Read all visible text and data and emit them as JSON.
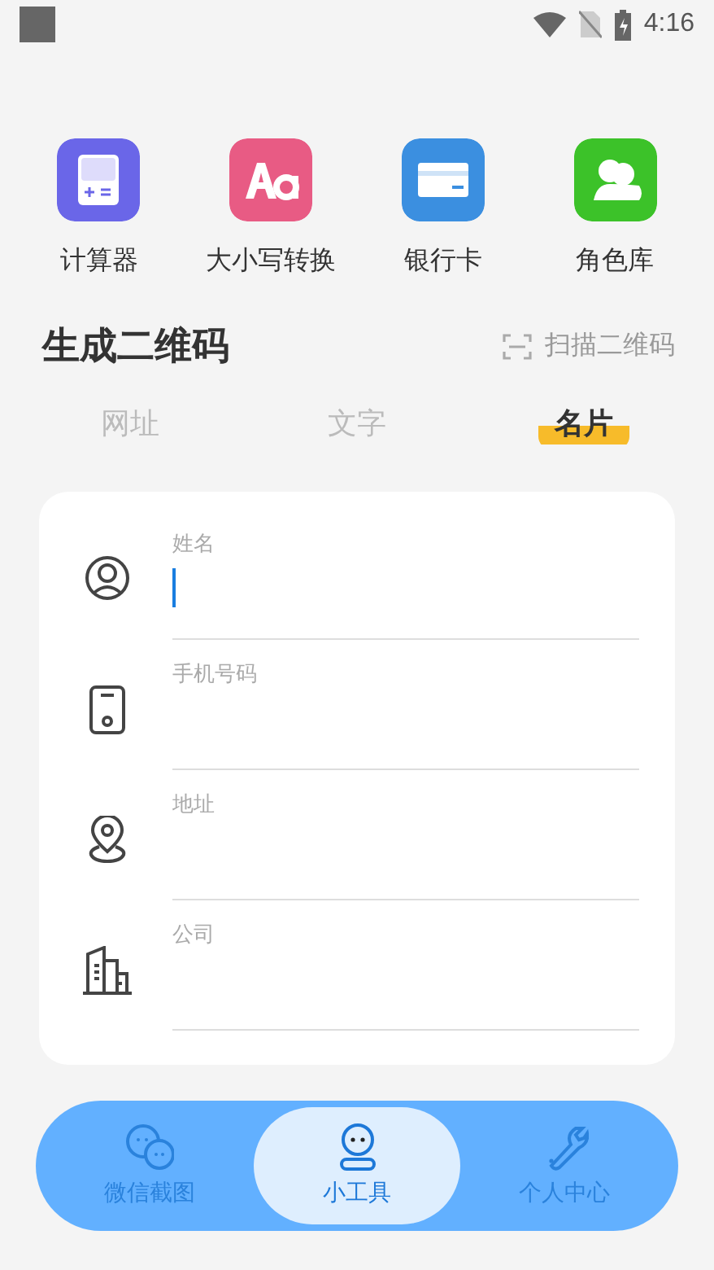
{
  "status_bar": {
    "time": "4:16"
  },
  "tools": [
    {
      "label": "计算器",
      "kind": "calculator",
      "color": "#6a66e8"
    },
    {
      "label": "大小写转换",
      "kind": "case",
      "color": "#e85b84"
    },
    {
      "label": "银行卡",
      "kind": "card",
      "color": "#3b8fe0"
    },
    {
      "label": "角色库",
      "kind": "people",
      "color": "#3cc229"
    }
  ],
  "section": {
    "title": "生成二维码",
    "scan_link": "扫描二维码"
  },
  "tabs": [
    {
      "label": "网址",
      "selected": false
    },
    {
      "label": "文字",
      "selected": false
    },
    {
      "label": "名片",
      "selected": true
    }
  ],
  "form": [
    {
      "kind": "person",
      "placeholder": "姓名",
      "focused": true
    },
    {
      "kind": "phone",
      "placeholder": "手机号码",
      "focused": false
    },
    {
      "kind": "location",
      "placeholder": "地址",
      "focused": false
    },
    {
      "kind": "company",
      "placeholder": "公司",
      "focused": false
    }
  ],
  "nav": [
    {
      "label": "微信截图",
      "kind": "chat",
      "selected": false
    },
    {
      "label": "小工具",
      "kind": "robot",
      "selected": true
    },
    {
      "label": "个人中心",
      "kind": "wrench",
      "selected": false
    }
  ]
}
